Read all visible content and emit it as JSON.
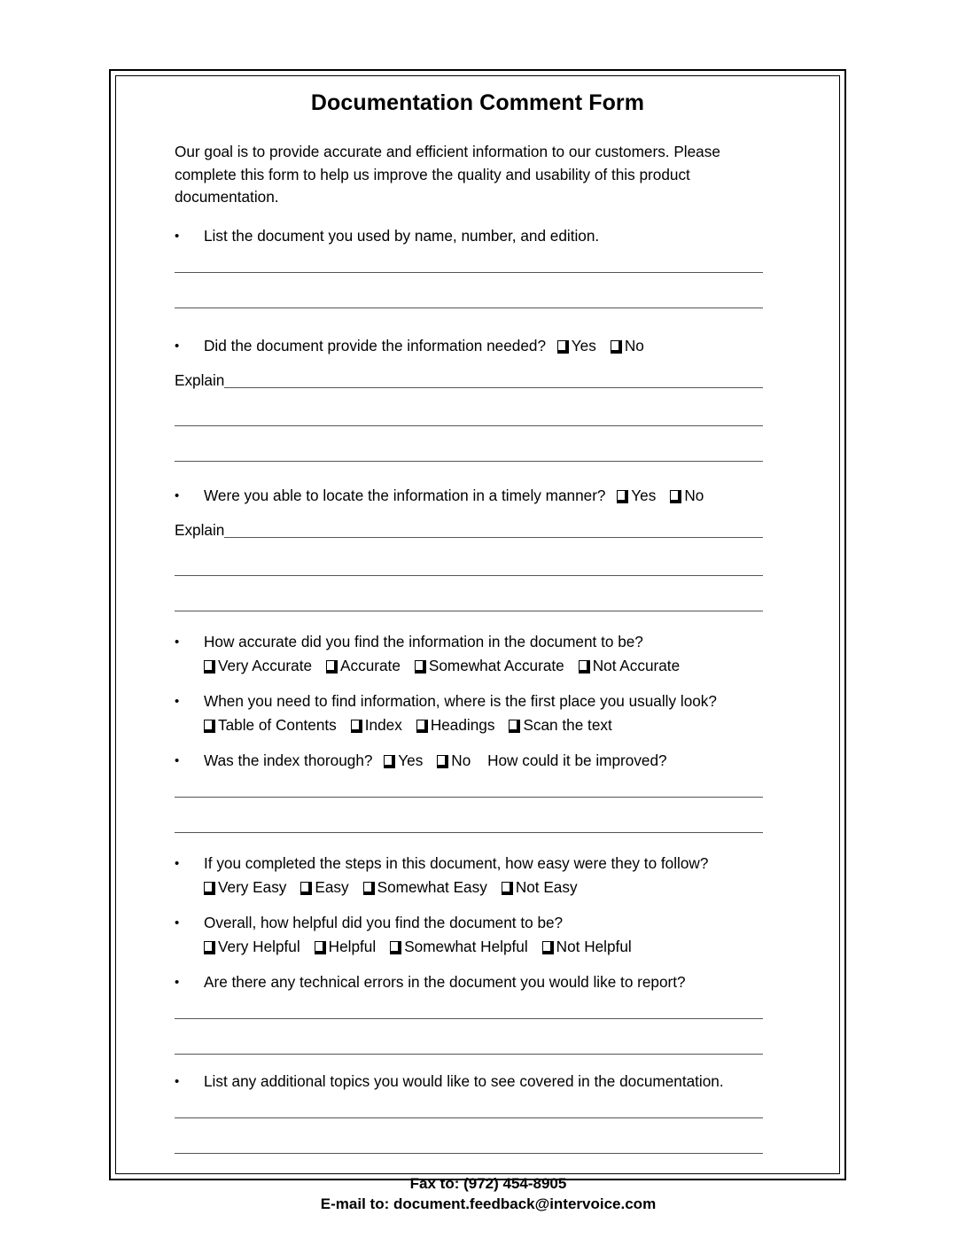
{
  "document": {
    "title": "Documentation Comment Form",
    "intro": "Our goal is to provide accurate and efficient information to our customers. Please complete this form to help us improve the quality and usability of this product documentation.",
    "bullet": "•",
    "explain_label": "Explain"
  },
  "questions": {
    "q1": {
      "text": "List the document you used by name, number, and edition."
    },
    "q2": {
      "text": "Did the document provide the information needed?",
      "options": [
        {
          "label": "Yes"
        },
        {
          "label": "No"
        }
      ]
    },
    "q3": {
      "text": "Were you able to locate the information in a timely manner?",
      "options": [
        {
          "label": "Yes"
        },
        {
          "label": "No"
        }
      ]
    },
    "q4": {
      "text": "How accurate did you find the information in the document to be?",
      "options": [
        {
          "label": "Very Accurate"
        },
        {
          "label": "Accurate"
        },
        {
          "label": "Somewhat Accurate"
        },
        {
          "label": "Not Accurate"
        }
      ]
    },
    "q5": {
      "text": "When you need to find information, where is the first place you usually look?",
      "options": [
        {
          "label": "Table of Contents"
        },
        {
          "label": "Index"
        },
        {
          "label": "Headings"
        },
        {
          "label": "Scan the text"
        }
      ]
    },
    "q6": {
      "text": "Was the index thorough?",
      "options": [
        {
          "label": "Yes"
        },
        {
          "label": "No"
        }
      ],
      "followup": "How could it be improved?"
    },
    "q7": {
      "text": "If you completed the steps in this document, how easy were they to follow?",
      "options": [
        {
          "label": "Very Easy"
        },
        {
          "label": "Easy"
        },
        {
          "label": "Somewhat Easy"
        },
        {
          "label": "Not Easy"
        }
      ]
    },
    "q8": {
      "text": "Overall, how helpful did you find the document to be?",
      "options": [
        {
          "label": "Very Helpful"
        },
        {
          "label": "Helpful"
        },
        {
          "label": "Somewhat Helpful"
        },
        {
          "label": "Not Helpful"
        }
      ]
    },
    "q9": {
      "text": "Are there any technical errors in the document you would like to report?"
    },
    "q10": {
      "text": "List any additional topics you would like to see covered in the documentation."
    }
  },
  "footer": {
    "fax": "Fax to: (972) 454-8905",
    "email": "E-mail to: document.feedback@intervoice.com"
  }
}
